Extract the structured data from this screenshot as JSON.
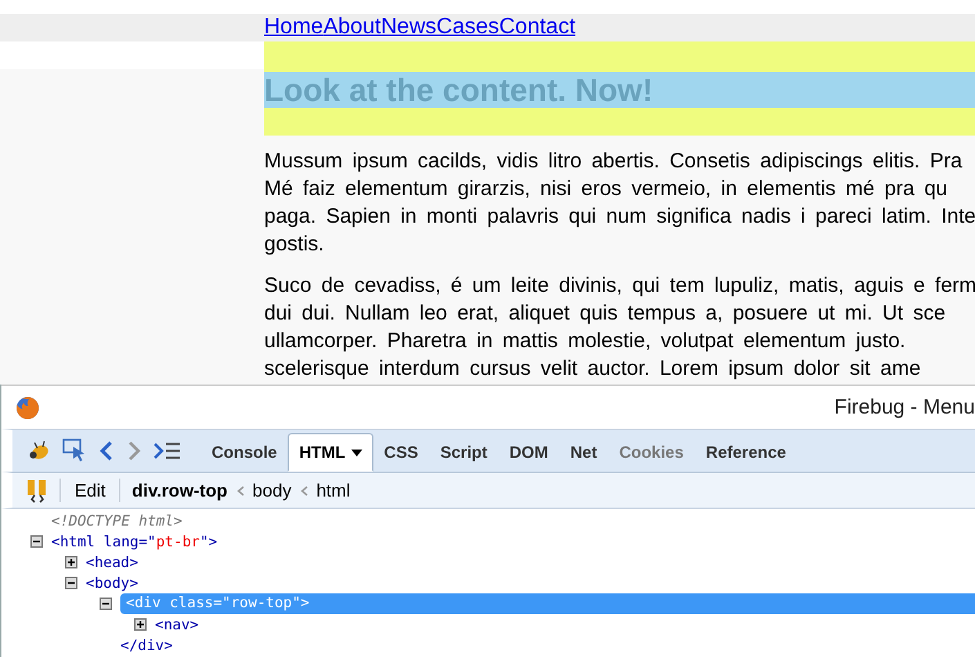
{
  "page": {
    "nav": [
      "Home",
      "About",
      "News",
      "Cases",
      "Contact"
    ],
    "heading": "Look at the content. Now!",
    "paragraphs": [
      [
        "Mussum ipsum cacilds, vidis litro abertis. Consetis adipiscings elitis. Pra",
        "Mé faiz elementum girarzis, nisi eros vermeio, in elementis mé pra qu",
        "paga. Sapien in monti palavris qui num significa nadis i pareci latim. Inte",
        "gostis."
      ],
      [
        "Suco de cevadiss, é um leite divinis, qui tem lupuliz, matis, aguis e ferm",
        "dui dui. Nullam leo erat, aliquet quis tempus a, posuere ut mi. Ut sce",
        "ullamcorper. Pharetra in mattis molestie, volutpat elementum justo.",
        "scelerisque interdum cursus velit auctor. Lorem ipsum dolor sit ame"
      ]
    ]
  },
  "firebug": {
    "title": "Firebug - Menu",
    "tabs": [
      {
        "label": "Console",
        "selected": false,
        "disabled": false
      },
      {
        "label": "HTML",
        "selected": true,
        "disabled": false
      },
      {
        "label": "CSS",
        "selected": false,
        "disabled": false
      },
      {
        "label": "Script",
        "selected": false,
        "disabled": false
      },
      {
        "label": "DOM",
        "selected": false,
        "disabled": false
      },
      {
        "label": "Net",
        "selected": false,
        "disabled": false
      },
      {
        "label": "Cookies",
        "selected": false,
        "disabled": true
      },
      {
        "label": "Reference",
        "selected": false,
        "disabled": false
      }
    ],
    "edit_button": "Edit",
    "breadcrumbs": [
      {
        "label": "div.row-top",
        "selected": true
      },
      {
        "label": "body",
        "selected": false
      },
      {
        "label": "html",
        "selected": false
      }
    ],
    "tree": [
      {
        "kind": "doctype",
        "text": "<!DOCTYPE html>"
      },
      {
        "kind": "element",
        "open": "<html lang=\"",
        "value": "pt-br",
        "close": "\">",
        "expanded": true,
        "selected": false,
        "children": [
          {
            "kind": "element",
            "open": "<head>",
            "expanded": false,
            "selected": false
          },
          {
            "kind": "element",
            "open": "<body>",
            "expanded": true,
            "selected": false,
            "children": [
              {
                "kind": "element",
                "open": "<div class=\"row-top\">",
                "expanded": true,
                "selected": true,
                "children": [
                  {
                    "kind": "element",
                    "open": "<nav>",
                    "expanded": false,
                    "selected": false
                  }
                ]
              },
              {
                "kind": "close",
                "text": "</div>"
              }
            ]
          }
        ]
      }
    ]
  }
}
